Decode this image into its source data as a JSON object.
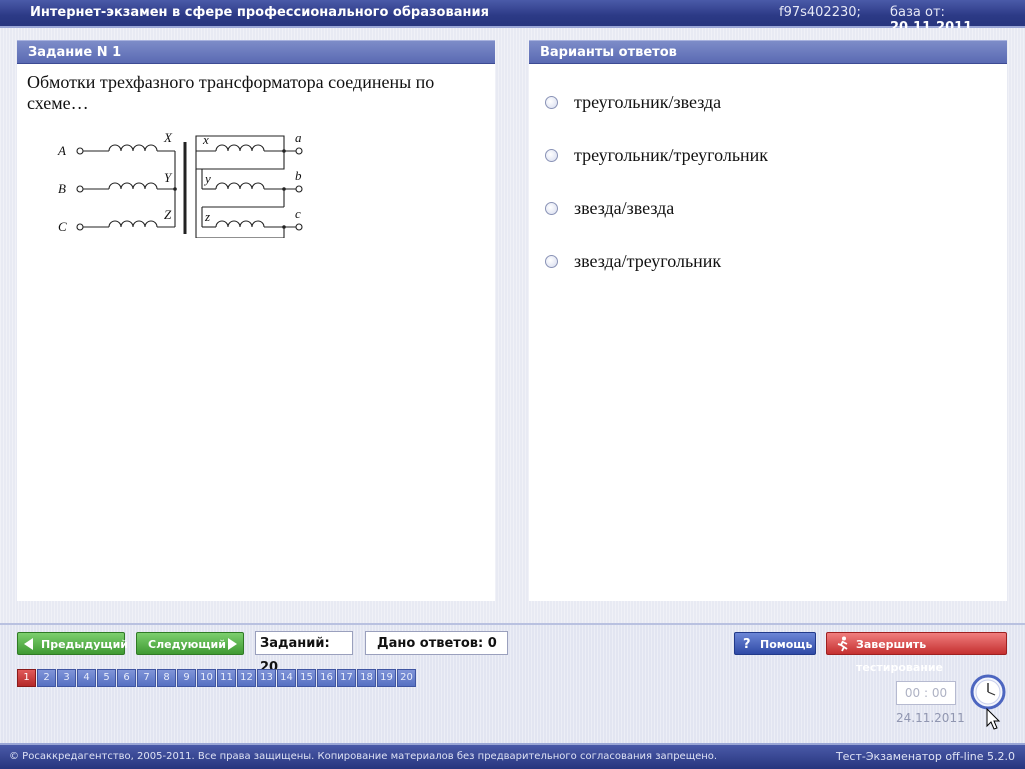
{
  "titlebar": {
    "title": "Интернет-экзамен в сфере профессионального образования",
    "code": "f97s402230;",
    "base_label": "база от:",
    "base_date": "20.11.2011"
  },
  "task": {
    "header": "Задание N 1",
    "question": "Обмотки трехфазного трансформатора соединены по схеме…",
    "diagram_labels": {
      "primary_terminals": [
        "A",
        "B",
        "C"
      ],
      "primary_ends": [
        "X",
        "Y",
        "Z"
      ],
      "secondary_starts": [
        "x",
        "y",
        "z"
      ],
      "secondary_terminals": [
        "a",
        "b",
        "c"
      ]
    }
  },
  "answers": {
    "header": "Варианты ответов",
    "options": [
      "треугольник/звезда",
      "треугольник/треугольник",
      "звезда/звезда",
      "звезда/треугольник"
    ]
  },
  "nav": {
    "prev_label": "Предыдущий",
    "next_label": "Следующий",
    "tasks_count": "Заданий: 20",
    "answers_given": "Дано ответов: 0",
    "help_label": "Помощь",
    "finish_label": "Завершить тестирование",
    "pages": [
      "1",
      "2",
      "3",
      "4",
      "5",
      "6",
      "7",
      "8",
      "9",
      "10",
      "11",
      "12",
      "13",
      "14",
      "15",
      "16",
      "17",
      "18",
      "19",
      "20"
    ],
    "active_page": "1"
  },
  "status": {
    "timer": "00 : 00",
    "date": "24.11.2011"
  },
  "footer": {
    "copyright": "© Росаккредагентство, 2005-2011. Все права защищены. Копирование материалов без предварительного согласования запрещено.",
    "version": "Тест-Экзаменатор off-line 5.2.0"
  },
  "colors": {
    "titlebar": "#2c3a86",
    "panel_header": "#6373bb",
    "active_page": "#c53030",
    "button_green": "#3f9a33",
    "button_red": "#c53030"
  }
}
